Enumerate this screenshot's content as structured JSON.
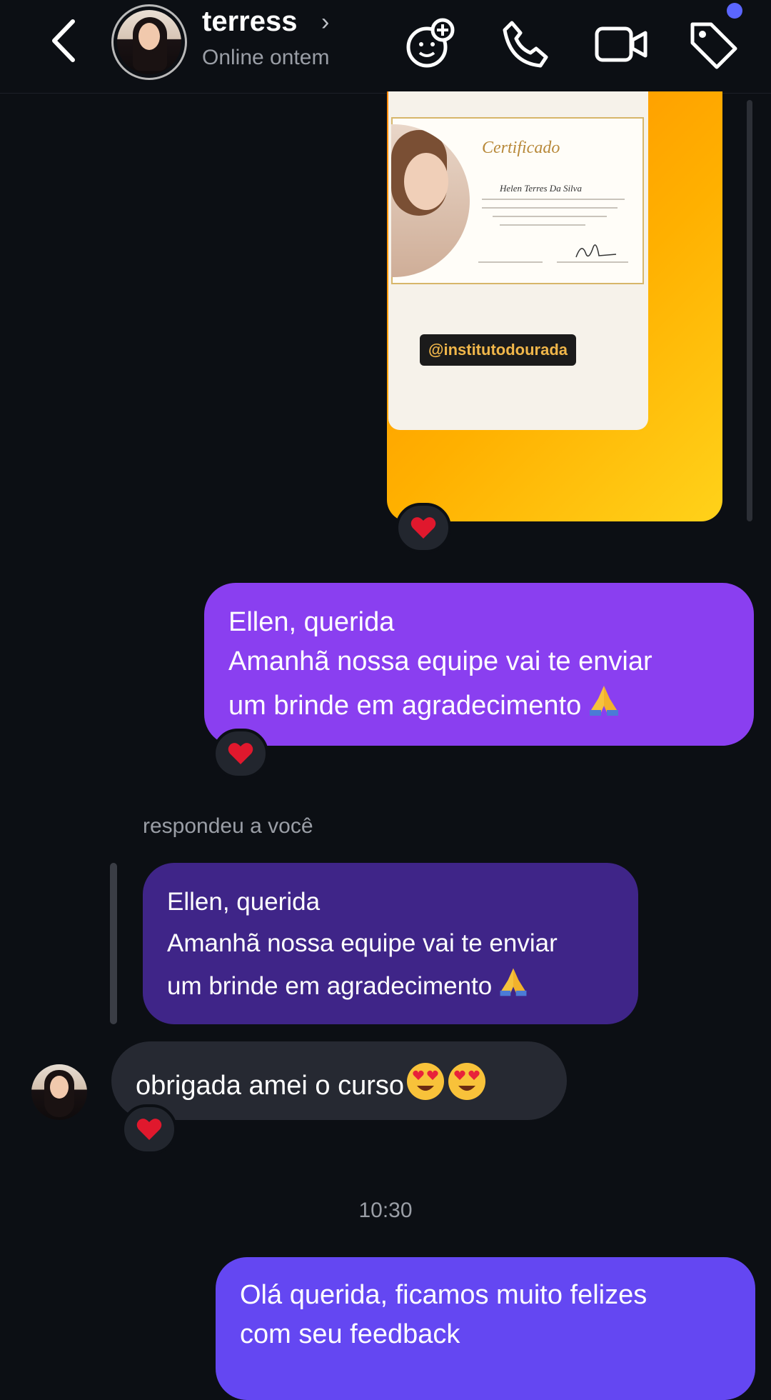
{
  "header": {
    "name": "terress",
    "status": "Online ontem",
    "icons": [
      "back-chevron-icon",
      "add-effect-icon",
      "phone-icon",
      "video-icon",
      "tag-icon"
    ],
    "accent_dot": "#5b66ff"
  },
  "shared_post": {
    "certificate_title": "Certificado",
    "certificate_name": "Helen Terres Da Silva",
    "handle": "@institutodourada",
    "gradient": [
      "#ff8a00",
      "#ffd21a"
    ]
  },
  "messages": [
    {
      "from": "me",
      "lines": [
        "Ellen, querida",
        "Amanhã nossa equipe vai te enviar",
        "um brinde em agradecimento"
      ],
      "emoji": "folded-hands",
      "reaction": "heart",
      "color": "#8a3ff0"
    },
    {
      "from": "them",
      "reply_label": "respondeu a você",
      "quoted_lines": [
        "Ellen, querida",
        "Amanhã nossa equipe vai te enviar",
        "um brinde em agradecimento"
      ],
      "quoted_emoji": "folded-hands",
      "color": "#3f2588"
    },
    {
      "from": "them",
      "text": "obrigada amei o curso",
      "emoji": [
        "heart-eyes",
        "heart-eyes"
      ],
      "reaction": "heart",
      "color": "#262932"
    },
    {
      "from": "me",
      "lines": [
        "Olá querida, ficamos muito felizes",
        "com seu feedback"
      ],
      "color": "#6447f2"
    }
  ],
  "timestamp": "10:30"
}
